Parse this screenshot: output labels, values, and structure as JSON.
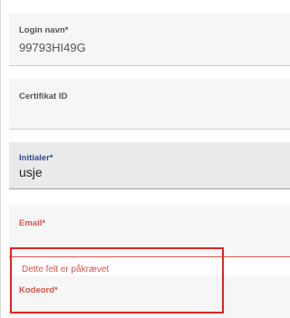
{
  "form": {
    "login": {
      "label": "Login navn*",
      "value": "99793HI49G"
    },
    "certificate": {
      "label": "Certifikat ID",
      "value": ""
    },
    "initials": {
      "label": "Initialer*",
      "value": "usje"
    },
    "email": {
      "label": "Email*",
      "value": "",
      "error": "Dette felt er påkrævet"
    },
    "password": {
      "label": "Kodeord*",
      "value": ""
    }
  },
  "colors": {
    "error": "#d9534f",
    "focus_label": "#344a8a",
    "highlight": "#e02424",
    "field_background": "#f6f6f6"
  }
}
